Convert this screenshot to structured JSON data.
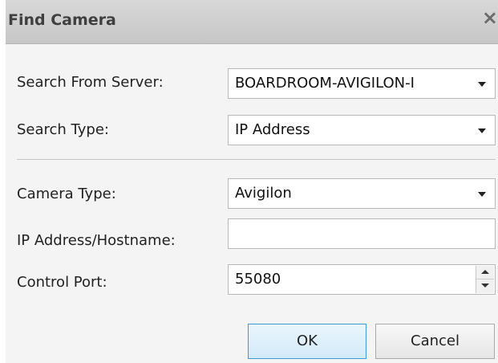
{
  "dialog": {
    "title": "Find Camera",
    "close_glyph": "×"
  },
  "form": {
    "search_from_server": {
      "label": "Search From Server:",
      "value": "BOARDROOM-AVIGILON-I"
    },
    "search_type": {
      "label": "Search Type:",
      "value": "IP Address"
    },
    "camera_type": {
      "label": "Camera Type:",
      "value": "Avigilon"
    },
    "ip_address": {
      "label": "IP Address/Hostname:",
      "value": ""
    },
    "control_port": {
      "label": "Control Port:",
      "value": "55080"
    }
  },
  "buttons": {
    "ok": "OK",
    "cancel": "Cancel"
  }
}
